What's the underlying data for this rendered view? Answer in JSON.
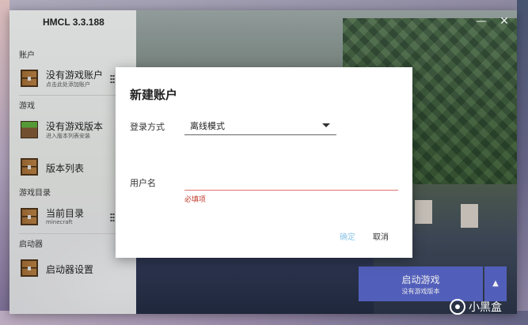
{
  "app": {
    "title": "HMCL 3.3.188"
  },
  "window_controls": {
    "minimize": "—",
    "close": "✕"
  },
  "sidebar": {
    "sections": [
      {
        "label": "账户"
      },
      {
        "label": "游戏"
      },
      {
        "label": "游戏目录"
      },
      {
        "label": "启动器"
      }
    ],
    "items": [
      {
        "title": "没有游戏账户",
        "subtitle": "点击此处添加账户",
        "icon": "chest-icon"
      },
      {
        "title": "没有游戏版本",
        "subtitle": "进入版本列表安装",
        "icon": "grass-block-icon"
      },
      {
        "title": "版本列表",
        "icon": "chest-icon"
      },
      {
        "title": "当前目录",
        "subtitle": "minecraft",
        "icon": "chest-icon"
      },
      {
        "title": "启动器设置",
        "icon": "chest-icon"
      }
    ]
  },
  "launch": {
    "label": "启动游戏",
    "sublabel": "没有游戏版本",
    "more_icon": "▲"
  },
  "dialog": {
    "title": "新建账户",
    "login_method_label": "登录方式",
    "login_method_value": "离线模式",
    "username_label": "用户名",
    "username_value": "",
    "username_error": "必填项",
    "confirm_label": "确定",
    "cancel_label": "取消"
  },
  "watermark": {
    "text": "小黑盒"
  },
  "colors": {
    "accent": "#5865c6",
    "error": "#c0392b",
    "confirm_disabled": "#8fc6e8"
  }
}
